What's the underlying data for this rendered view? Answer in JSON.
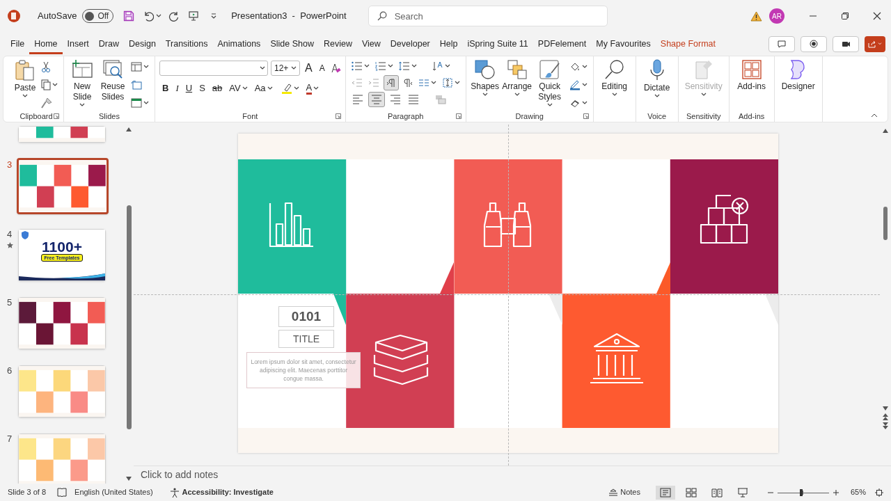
{
  "title_bar": {
    "autosave_label": "AutoSave",
    "autosave_toggle": {
      "label": "Off",
      "on": false
    },
    "document_title": "Presentation3  -  PowerPoint",
    "search": {
      "placeholder": "Search"
    },
    "avatar": "AR"
  },
  "menu_tabs": [
    {
      "label": "File",
      "selected": false,
      "contextual": false
    },
    {
      "label": "Home",
      "selected": true,
      "contextual": false
    },
    {
      "label": "Insert",
      "selected": false,
      "contextual": false
    },
    {
      "label": "Draw",
      "selected": false,
      "contextual": false
    },
    {
      "label": "Design",
      "selected": false,
      "contextual": false
    },
    {
      "label": "Transitions",
      "selected": false,
      "contextual": false
    },
    {
      "label": "Animations",
      "selected": false,
      "contextual": false
    },
    {
      "label": "Slide Show",
      "selected": false,
      "contextual": false
    },
    {
      "label": "Review",
      "selected": false,
      "contextual": false
    },
    {
      "label": "View",
      "selected": false,
      "contextual": false
    },
    {
      "label": "Developer",
      "selected": false,
      "contextual": false
    },
    {
      "label": "Help",
      "selected": false,
      "contextual": false
    },
    {
      "label": "iSpring Suite 11",
      "selected": false,
      "contextual": false
    },
    {
      "label": "PDFelement",
      "selected": false,
      "contextual": false
    },
    {
      "label": "My Favourites",
      "selected": false,
      "contextual": false
    },
    {
      "label": "Shape Format",
      "selected": false,
      "contextual": true
    }
  ],
  "ribbon": {
    "clipboard": {
      "label": "Clipboard",
      "paste": "Paste"
    },
    "slides": {
      "label": "Slides",
      "new_slide": "New Slide",
      "reuse_slides": "Reuse Slides"
    },
    "font": {
      "label": "Font",
      "size": "12+",
      "grow": "A",
      "shrink": "A",
      "buttons": [
        "B",
        "I",
        "U",
        "S",
        "ab",
        "AV",
        "Aa"
      ],
      "font_color": "A"
    },
    "paragraph": {
      "label": "Paragraph",
      "left_to_right": true,
      "align": [
        {
          "selected": false
        },
        {
          "selected": true
        },
        {
          "selected": false
        },
        {
          "selected": false
        }
      ]
    },
    "drawing": {
      "label": "Drawing",
      "buttons": [
        "Shapes",
        "Arrange",
        "Quick Styles"
      ]
    },
    "editing": {
      "button": "Editing"
    },
    "voice": {
      "label": "Voice",
      "button": "Dictate"
    },
    "sensitivity": {
      "label": "Sensitivity",
      "button": "Sensitivity",
      "disabled": true
    },
    "add_ins": {
      "label": "Add-ins",
      "button": "Add-ins"
    },
    "designer": {
      "button": "Designer"
    }
  },
  "thumbnails": [
    {
      "kind": "partial",
      "selected": false,
      "tiles": [
        {
          "color": "#1fbc9c"
        },
        {
          "color": "#d13f53"
        }
      ]
    },
    {
      "kind": "tiles",
      "number": "3",
      "selected": true,
      "starred": false,
      "tiles": [
        {
          "color": "#1fbc9c"
        },
        {
          "color": "#d13f53"
        },
        {
          "color": "#f25c54"
        },
        {
          "color": "#fe5a30"
        },
        {
          "color": "#9b1a4b"
        }
      ]
    },
    {
      "kind": "promo",
      "number": "4",
      "selected": false,
      "starred": true,
      "headline": "1100+",
      "badge": "Free Templates"
    },
    {
      "kind": "tiles",
      "number": "5",
      "selected": false,
      "starred": false,
      "tiles": [
        {
          "color": "#5c1a3a"
        },
        {
          "color": "#6a1535"
        },
        {
          "color": "#8f1640"
        },
        {
          "color": "#c8334d"
        },
        {
          "color": "#f25c54"
        }
      ]
    },
    {
      "kind": "tiles",
      "number": "6",
      "selected": false,
      "starred": false,
      "tiles": [
        {
          "color": "#fde68a"
        },
        {
          "color": "#fdb47e"
        },
        {
          "color": "#fcd87a"
        },
        {
          "color": "#f98b86"
        },
        {
          "color": "#fbc8a8"
        }
      ]
    },
    {
      "kind": "tiles",
      "number": "7",
      "selected": false,
      "starred": false,
      "tiles": [
        {
          "color": "#fde68a"
        },
        {
          "color": "#fdba74"
        },
        {
          "color": "#fcd680"
        },
        {
          "color": "#fb9a8a"
        },
        {
          "color": "#fcc8a8"
        }
      ]
    }
  ],
  "slide": {
    "tiles": [
      {
        "color": "#1fbc9c"
      },
      {
        "color": "#d13f53"
      },
      {
        "color": "#f25c54"
      },
      {
        "color": "#fe5a30"
      },
      {
        "color": "#9b1a4b"
      }
    ],
    "number": "0101",
    "title": "TITLE",
    "body": "Lorem ipsum dolor sit amet, consectetur adipiscing elit. Maecenas porttitor congue massa."
  },
  "notes": {
    "placeholder": "Click to add notes"
  },
  "status_bar": {
    "slide_counter": "Slide 3 of 8",
    "language": "English (United States)",
    "accessibility": "Accessibility: Investigate",
    "notes_button": "Notes",
    "views": [
      {
        "selected": true
      },
      {
        "selected": false
      },
      {
        "selected": false
      },
      {
        "selected": false
      }
    ],
    "zoom": {
      "level": 0.46,
      "reading": "65%"
    }
  }
}
